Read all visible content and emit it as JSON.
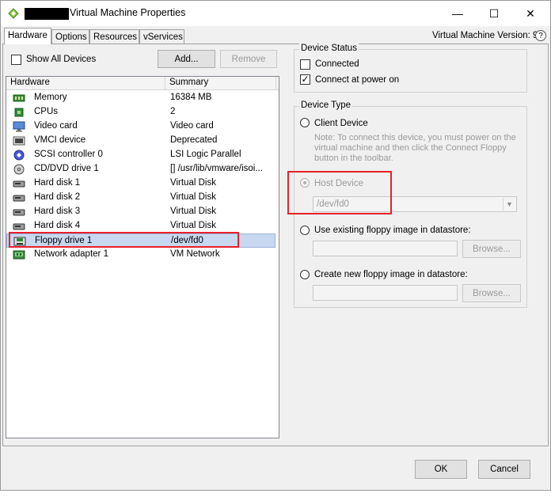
{
  "window": {
    "title": "Virtual Machine Properties",
    "min_glyph": "—",
    "max_glyph": "☐",
    "close_glyph": "✕"
  },
  "tabs": [
    {
      "label": "Hardware",
      "active": true
    },
    {
      "label": "Options",
      "active": false
    },
    {
      "label": "Resources",
      "active": false
    },
    {
      "label": "vServices",
      "active": false
    }
  ],
  "vm_version": "Virtual Machine Version: 9",
  "help_glyph": "?",
  "show_all_devices": {
    "label": "Show All Devices",
    "checked": false
  },
  "buttons": {
    "add": "Add...",
    "remove": "Remove",
    "ok": "OK",
    "cancel": "Cancel"
  },
  "hardware_table": {
    "columns": [
      "Hardware",
      "Summary"
    ],
    "rows": [
      {
        "name": "Memory",
        "summary": "16384 MB",
        "icon": "memory-icon"
      },
      {
        "name": "CPUs",
        "summary": "2",
        "icon": "cpu-icon"
      },
      {
        "name": "Video card",
        "summary": "Video card",
        "icon": "monitor-icon"
      },
      {
        "name": "VMCI device",
        "summary": "Deprecated",
        "icon": "vmci-icon"
      },
      {
        "name": "SCSI controller 0",
        "summary": "LSI Logic Parallel",
        "icon": "scsi-icon"
      },
      {
        "name": "CD/DVD drive 1",
        "summary": "[] /usr/lib/vmware/isoi...",
        "icon": "cd-dvd-icon"
      },
      {
        "name": "Hard disk 1",
        "summary": "Virtual Disk",
        "icon": "hard-disk-icon"
      },
      {
        "name": "Hard disk 2",
        "summary": "Virtual Disk",
        "icon": "hard-disk-icon"
      },
      {
        "name": "Hard disk 3",
        "summary": "Virtual Disk",
        "icon": "hard-disk-icon"
      },
      {
        "name": "Hard disk 4",
        "summary": "Virtual Disk",
        "icon": "hard-disk-icon"
      },
      {
        "name": "Floppy drive 1",
        "summary": "/dev/fd0",
        "icon": "floppy-icon",
        "selected": true
      },
      {
        "name": "Network adapter 1",
        "summary": "VM Network",
        "icon": "network-adapter-icon"
      }
    ]
  },
  "device_status": {
    "title": "Device Status",
    "connected": {
      "label": "Connected",
      "checked": false
    },
    "connect_at_power_on": {
      "label": "Connect at power on",
      "checked": true
    }
  },
  "device_type": {
    "title": "Device Type",
    "client_device": {
      "label": "Client Device",
      "selected": false
    },
    "hint": "Note: To connect this device, you must power on the virtual machine and then click the Connect Floppy button in the toolbar.",
    "host_device": {
      "label": "Host Device",
      "selected": true,
      "disabled": true,
      "value": "/dev/fd0"
    },
    "use_existing": {
      "label": "Use existing floppy image in datastore:",
      "browse": "Browse..."
    },
    "create_new": {
      "label": "Create new floppy image in datastore:",
      "browse": "Browse..."
    }
  },
  "colors": {
    "highlight_box": "#e8202a",
    "selection": "#c8d8f0"
  }
}
